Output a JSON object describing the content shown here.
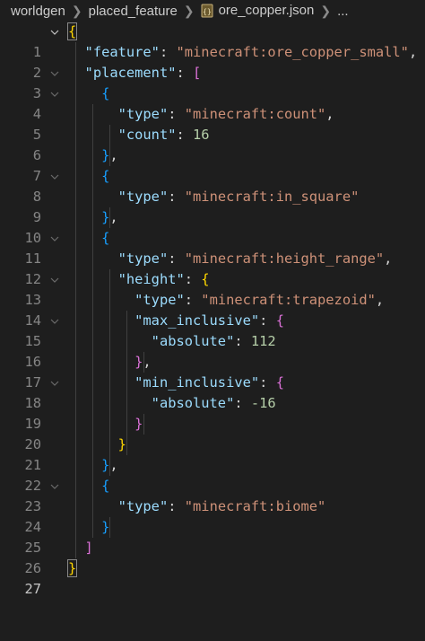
{
  "breadcrumb": {
    "items": [
      "worldgen",
      "placed_feature",
      "ore_copper.json",
      "..."
    ],
    "separator": ">"
  },
  "line_numbers": [
    "1",
    "2",
    "3",
    "4",
    "5",
    "6",
    "7",
    "8",
    "9",
    "10",
    "11",
    "12",
    "13",
    "14",
    "15",
    "16",
    "17",
    "18",
    "19",
    "20",
    "21",
    "22",
    "23",
    "24",
    "25",
    "26",
    "27"
  ],
  "code": {
    "feature_key": "\"feature\"",
    "feature_value": "\"minecraft:ore_copper_small\"",
    "placement_key": "\"placement\"",
    "type_key": "\"type\"",
    "count_type": "\"minecraft:count\"",
    "count_key": "\"count\"",
    "count_value": "16",
    "in_square_type": "\"minecraft:in_square\"",
    "height_range_type": "\"minecraft:height_range\"",
    "height_key": "\"height\"",
    "trapezoid_type": "\"minecraft:trapezoid\"",
    "max_inclusive_key": "\"max_inclusive\"",
    "absolute_key": "\"absolute\"",
    "max_value": "112",
    "min_inclusive_key": "\"min_inclusive\"",
    "min_value": "-16",
    "biome_type": "\"minecraft:biome\""
  },
  "colors": {
    "background": "#1e1e1e",
    "key": "#9cdcfe",
    "string": "#ce9178",
    "number": "#b5cea8",
    "bracket_level1": "#ffd700",
    "bracket_level2": "#da70d6",
    "bracket_level3": "#179fff"
  },
  "icons": {
    "file": "json-file-icon",
    "fold": "chevron-down-icon",
    "separator": "chevron-right-icon"
  }
}
